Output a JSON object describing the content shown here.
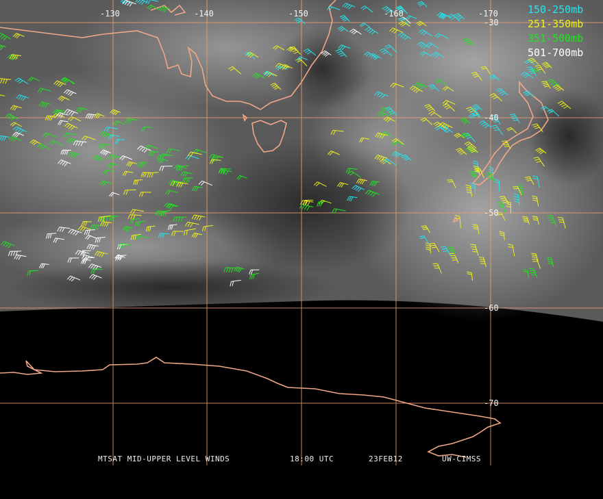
{
  "legend": [
    {
      "label": "150-250mb",
      "color": "#22e6f0"
    },
    {
      "label": "251-350mb",
      "color": "#f2f21a"
    },
    {
      "label": "351-500mb",
      "color": "#1ee61e"
    },
    {
      "label": "501-700mb",
      "color": "#ffffff"
    }
  ],
  "longitude_labels": [
    "-130",
    "-140",
    "-150",
    "-160",
    "-170"
  ],
  "latitude_labels": [
    "-30",
    "-40",
    "-50",
    "-60",
    "-70"
  ],
  "footer": {
    "product": "MTSAT MID-UPPER LEVEL WINDS",
    "time": "18:00 UTC",
    "date": "23FEB12",
    "source": "UW-CIMSS"
  },
  "colors": {
    "coastline": "#f0a888",
    "grid": "#e8a070",
    "imagery_dark": "#3a3a3a",
    "imagery_light": "#8a8a8a",
    "space": "#000000"
  }
}
